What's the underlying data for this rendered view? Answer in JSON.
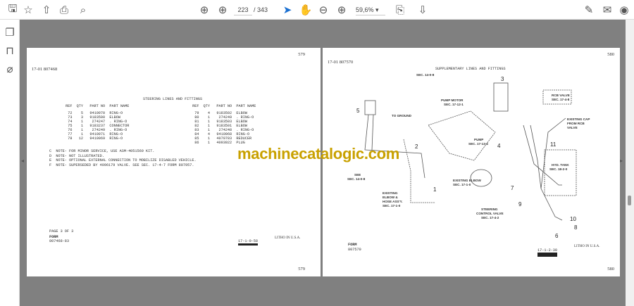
{
  "toolbar": {
    "page_current": "223",
    "page_total": "/ 343",
    "zoom": "59,6%",
    "icons": [
      "save-icon",
      "bookmark-star-icon",
      "upload-icon",
      "print-icon",
      "find-icon",
      "prev-page-icon",
      "next-page-icon",
      "select-cursor-icon",
      "hand-icon",
      "zoom-out-icon",
      "zoom-in-icon",
      "page-fit-icon",
      "scroll-mode-icon",
      "sign-icon",
      "email-icon",
      "account-icon"
    ]
  },
  "sidebar": {
    "icons": [
      "pages-icon",
      "bookmarks-icon",
      "attachments-icon"
    ]
  },
  "watermark": "machinecatalogic.com",
  "left_page": {
    "page_num": "579",
    "header": "17-01  807468",
    "title": "STEERING LINES AND FITTINGS",
    "col_headers": [
      "REF",
      "QTY",
      "PART NO",
      "PART NAME"
    ],
    "rows_left": [
      [
        "72",
        "5",
        "9410970",
        "RING-O"
      ],
      [
        "73",
        "3",
        "9183500",
        "ELBOW"
      ],
      [
        "74",
        "1",
        "274247",
        ". RING-O"
      ],
      [
        "75",
        "1",
        "9183237",
        "CONNECTOR"
      ],
      [
        "76",
        "1",
        "274249",
        ". RING-O"
      ],
      [
        "77",
        "1",
        "9410971",
        "RING-O"
      ],
      [
        "78",
        "12",
        "9410969",
        "RING-O"
      ]
    ],
    "rows_right": [
      [
        "79",
        "4",
        "9183502",
        "ELBOW"
      ],
      [
        "80",
        "1",
        "274249",
        ". RING-O"
      ],
      [
        "81",
        "1",
        "9183503",
        "ELBOW"
      ],
      [
        "82",
        "1",
        "9183501",
        "ELBOW"
      ],
      [
        "83",
        "1",
        "274248",
        ". RING-O"
      ],
      [
        "84",
        "4",
        "9410968",
        "RING-O"
      ],
      [
        "85",
        "1",
        "4079783",
        "REDUCER"
      ],
      [
        "86",
        "1",
        "4093922",
        "PLUG"
      ]
    ],
    "notes": [
      "C  NOTE- FOR MINOR SERVICE, USE ASM-4051560 KIT.",
      "D  NOTE- NOT ILLUSTRATED.",
      "E  NOTE- OPTIONAL EXTERNAL CONNECTION TO MOBILIZE DISABLED VEHICLE.",
      "F  NOTE- SUPERSEDED BY 4096179 VALVE. SEE SEC. 17-4-7 FORM 807957."
    ],
    "page_of": "PAGE 3 OF 3",
    "form_label": "FORM",
    "form_no": "807468-83",
    "stamp": "17-1-0-58",
    "litho": "LITHO IN U.S.A."
  },
  "right_page": {
    "page_num": "580",
    "header": "17-01  807570",
    "title": "SUPPLEMENTARY LINES AND FITTINGS",
    "labels": {
      "sec1": "SEC. 14-0-8",
      "pump_motor": "PUMP MOTOR",
      "pump_motor_sec": "SEC. 17-12-1",
      "ground": "TO GROUND",
      "pump": "PUMP",
      "pump_sec": "SEC. 17-13-4",
      "see": "SEE",
      "see_sec": "SEC. 14-0-8",
      "rcb": "RCB VALVE",
      "rcb_sec": "SEC. 17-4-8",
      "cap1": "EXISTING CAP",
      "cap2": "FROM RCB",
      "cap3": "VALVE",
      "elbow": "EXISTING ELBOW",
      "elbow_sec": "SEC. 17-1-0",
      "ex1": "EXISTING",
      "ex2": "ELBOW &",
      "ex3": "HOSE ASS'Y.",
      "ex4": "SEC. 17-1-0",
      "sc1": "STEERING",
      "sc2": "CONTROL VALVE",
      "sc3": "SEC. 17-4-2",
      "tank": "HYD. TANK",
      "tank_sec": "SEC. 18-2-0"
    },
    "callouts": [
      "1",
      "2",
      "3",
      "4",
      "5",
      "6",
      "7",
      "8",
      "9",
      "10",
      "11"
    ],
    "form_label": "FORM",
    "form_no": "807570",
    "stamp": "17-1-2-30",
    "litho": "LITHO IN U.S.A."
  }
}
